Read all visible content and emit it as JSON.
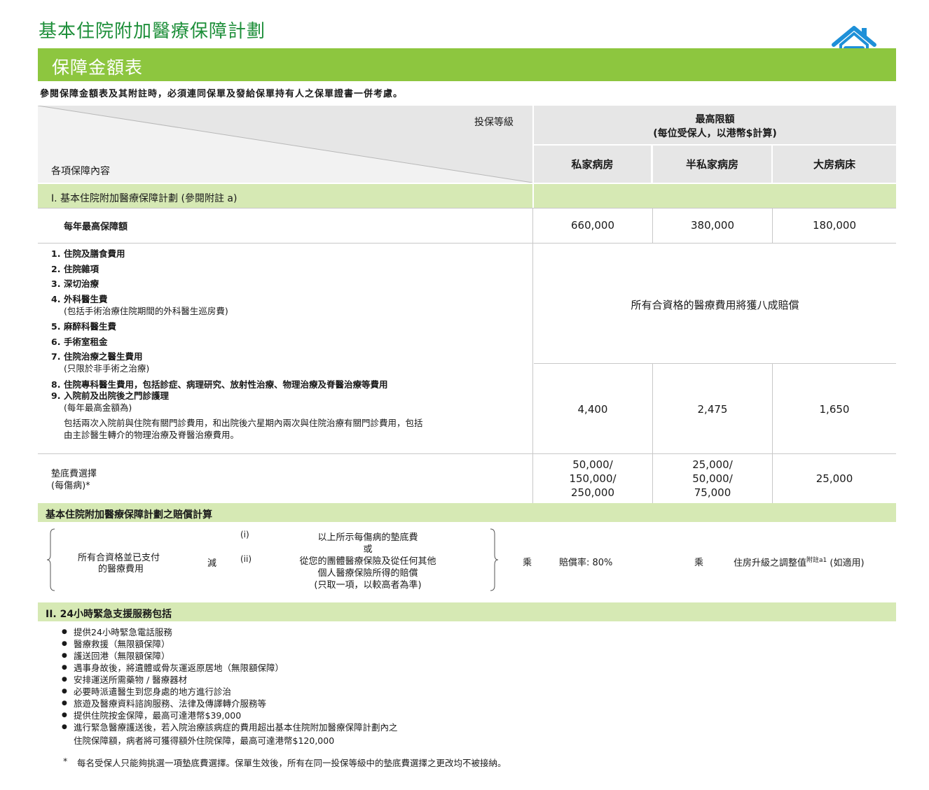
{
  "title": "基本住院附加醫療保障計劃",
  "banner": "保障金額表",
  "intro": "參閱保障金額表及其附註時，必須連同保單及發給保單持有人之保單證書一併考慮。",
  "header": {
    "plan_level": "投保等級",
    "benefit_items": "各項保障內容",
    "max_limit_line1": "最高限額",
    "max_limit_line2": "(每位受保人，以港幣$計算)",
    "columns": [
      "私家病房",
      "半私家病房",
      "大房病床"
    ]
  },
  "section1": {
    "title": "I. 基本住院附加醫療保障計劃 (參閱附註 a)",
    "annual_label": "每年最高保障額",
    "annual_values": [
      "660,000",
      "380,000",
      "180,000"
    ],
    "items": [
      {
        "num": "1.",
        "text": "住院及膳食費用"
      },
      {
        "num": "2.",
        "text": "住院雜項"
      },
      {
        "num": "3.",
        "text": "深切治療"
      },
      {
        "num": "4.",
        "text": "外科醫生費",
        "sub": "(包括手術治療住院期間的外科醫生巡房費)"
      },
      {
        "num": "5.",
        "text": "麻醉科醫生費"
      },
      {
        "num": "6.",
        "text": "手術室租金"
      },
      {
        "num": "7.",
        "text": "住院治療之醫生費用",
        "sub": "(只限於非手術之治療)"
      }
    ],
    "reimburse_text": "所有合資格的醫療費用將獲八成賠償",
    "item8": {
      "num": "8.",
      "text": "住院專科醫生費用，包括診症、病理研究、放射性治療、物理治療及脊醫治療等費用"
    },
    "item9": {
      "num": "9.",
      "text": "入院前及出院後之門診護理",
      "sub": "(每年最高金額為)"
    },
    "item9_note1": "包括兩次入院前與住院有關門診費用，和出院後六星期內兩次與住院治療有關門診費用，包括",
    "item9_note2": "由主診醫生轉介的物理治療及脊醫治療費用。",
    "outpatient_values": [
      "4,400",
      "2,475",
      "1,650"
    ],
    "deductible_label1": "墊底費選擇",
    "deductible_label2": "(每傷病)*",
    "deductible_values": [
      [
        "50,000/",
        "150,000/",
        "250,000"
      ],
      [
        "25,000/",
        "50,000/",
        "75,000"
      ],
      [
        "25,000"
      ]
    ]
  },
  "calc": {
    "title": "基本住院附加醫療保障計劃之賠償計算",
    "eligible1": "所有合資格並已支付",
    "eligible2": "的醫療費用",
    "minus": "減",
    "opt_i": "(i)",
    "opt_ii": "(ii)",
    "i_text": "以上所示每傷病的墊底費",
    "or": "或",
    "ii_line1": "從您的團體醫療保險及從任何其他",
    "ii_line2": "個人醫療保險所得的賠償",
    "ii_line3": "(只取一項，以較高者為準)",
    "times1": "乘",
    "rate": "賠償率: 80%",
    "times2": "乘",
    "adjust": "住房升級之調整值",
    "adjust_sup": "附註a1",
    "adjust_tail": "(如適用)"
  },
  "section2": {
    "title": "II. 24小時緊急支援服務包括",
    "bullets": [
      "提供24小時緊急電話服務",
      "醫療救援（無限額保障）",
      "護送回港（無限額保障）",
      "遇事身故後，將遺體或骨灰運返原居地（無限額保障）",
      "安排運送所需藥物 / 醫療器材",
      "必要時派遣醫生到您身處的地方進行診治",
      "旅遊及醫療資料諮詢服務、法律及傳譯轉介服務等",
      "提供住院按金保障，最高可達港幣$39,000",
      "進行緊急醫療護送後，若入院治療該病症的費用超出基本住院附加醫療保障計劃內之"
    ],
    "bullet_cont": "住院保障額，病者將可獲得額外住院保障，最高可達港幣$120,000"
  },
  "footnote_mark": "*",
  "footnote": "每名受保人只能夠挑選一項墊底費選擇。保單生效後，所有在同一投保等級中的墊底費選擇之更改均不被接納。",
  "colors": {
    "green_title": "#1e8f3a",
    "banner": "#8dc63f",
    "row_green": "#d6e9b4",
    "header_grey": "#e6e6e6",
    "icon_blue": "#1e90d8"
  }
}
